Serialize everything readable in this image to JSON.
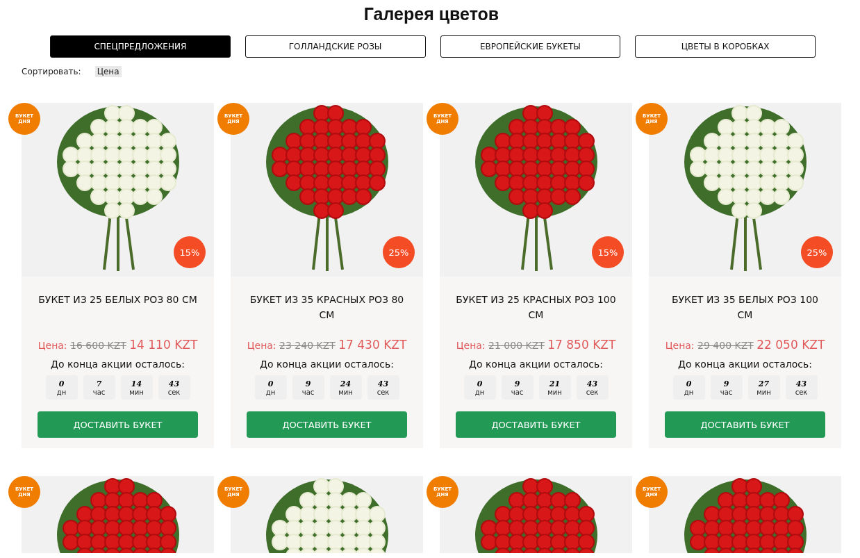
{
  "title": "Галерея цветов",
  "tabs": [
    {
      "label": "СПЕЦПРЕДЛОЖЕНИЯ",
      "selected": true
    },
    {
      "label": "ГОЛЛАНДСКИЕ РОЗЫ",
      "selected": false
    },
    {
      "label": "ЕВРОПЕЙСКИЕ БУКЕТЫ",
      "selected": false
    },
    {
      "label": "ЦВЕТЫ В КОРОБКАХ",
      "selected": false
    }
  ],
  "sort": {
    "label": "Сортировать:",
    "option": "Цена"
  },
  "products": [
    {
      "badge": "БУКЕТ ДНЯ",
      "photo": {
        "kind": "white"
      },
      "discount": "15%",
      "name": "БУКЕТ ИЗ 25 БЕЛЫХ РОЗ 80 СМ",
      "price_label": "Цена:",
      "old_price": "16 600 KZT",
      "new_price": "14 110 KZT",
      "countdown_label": "До конца акции осталось:",
      "countdown": [
        {
          "value": "0",
          "unit": "дн"
        },
        {
          "value": "7",
          "unit": "час"
        },
        {
          "value": "14",
          "unit": "мин"
        },
        {
          "value": "43",
          "unit": "сек"
        }
      ],
      "button": "ДОСТАВИТЬ БУКЕТ"
    },
    {
      "badge": "БУКЕТ ДНЯ",
      "photo": {
        "kind": "red"
      },
      "discount": "25%",
      "name": "БУКЕТ ИЗ 35 КРАСНЫХ РОЗ 80 СМ",
      "price_label": "Цена:",
      "old_price": "23 240 KZT",
      "new_price": "17 430 KZT",
      "countdown_label": "До конца акции осталось:",
      "countdown": [
        {
          "value": "0",
          "unit": "дн"
        },
        {
          "value": "9",
          "unit": "час"
        },
        {
          "value": "24",
          "unit": "мин"
        },
        {
          "value": "43",
          "unit": "сек"
        }
      ],
      "button": "ДОСТАВИТЬ БУКЕТ"
    },
    {
      "badge": "БУКЕТ ДНЯ",
      "photo": {
        "kind": "red"
      },
      "discount": "15%",
      "name": "БУКЕТ ИЗ 25 КРАСНЫХ РОЗ 100 СМ",
      "price_label": "Цена:",
      "old_price": "21 000 KZT",
      "new_price": "17 850 KZT",
      "countdown_label": "До конца акции осталось:",
      "countdown": [
        {
          "value": "0",
          "unit": "дн"
        },
        {
          "value": "9",
          "unit": "час"
        },
        {
          "value": "21",
          "unit": "мин"
        },
        {
          "value": "43",
          "unit": "сек"
        }
      ],
      "button": "ДОСТАВИТЬ БУКЕТ"
    },
    {
      "badge": "БУКЕТ ДНЯ",
      "photo": {
        "kind": "white"
      },
      "discount": "25%",
      "name": "БУКЕТ ИЗ 35 БЕЛЫХ РОЗ 100 СМ",
      "price_label": "Цена:",
      "old_price": "29 400 KZT",
      "new_price": "22 050 KZT",
      "countdown_label": "До конца акции осталось:",
      "countdown": [
        {
          "value": "0",
          "unit": "дн"
        },
        {
          "value": "9",
          "unit": "час"
        },
        {
          "value": "27",
          "unit": "мин"
        },
        {
          "value": "43",
          "unit": "сек"
        }
      ],
      "button": "ДОСТАВИТЬ БУКЕТ"
    },
    {
      "badge": "БУКЕТ ДНЯ",
      "photo": {
        "kind": "red"
      }
    },
    {
      "badge": "БУКЕТ ДНЯ",
      "photo": {
        "kind": "white"
      }
    },
    {
      "badge": "БУКЕТ ДНЯ",
      "photo": {
        "kind": "red"
      }
    },
    {
      "badge": "БУКЕТ ДНЯ",
      "photo": {
        "kind": "red"
      }
    }
  ]
}
